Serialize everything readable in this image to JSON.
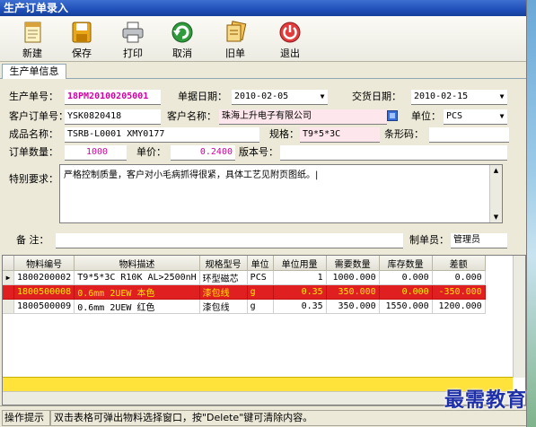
{
  "window": {
    "title": "生产订单录入"
  },
  "toolbar": {
    "new_label": "新建",
    "save_label": "保存",
    "print_label": "打印",
    "cancel_label": "取消",
    "old_label": "旧单",
    "exit_label": "退出"
  },
  "tab": {
    "label": "生产单信息"
  },
  "form": {
    "order_no_label": "生产单号：",
    "order_no": "18PM20100205001",
    "doc_date_label": "单据日期：",
    "doc_date": "2010-02-05",
    "delivery_date_label": "交货日期：",
    "delivery_date": "2010-02-15",
    "cust_order_label": "客户订单号：",
    "cust_order": "YSK0820418",
    "cust_name_label": "客户名称：",
    "cust_name": "珠海上升电子有限公司",
    "unit_label": "单位：",
    "unit": "PCS",
    "product_label": "成品名称：",
    "product": "TSRB-L0001    XMY0177",
    "spec_label": "规格：",
    "spec": "T9*5*3C",
    "barcode_label": "条形码：",
    "barcode": "",
    "qty_label": "订单数量：",
    "qty": "1000",
    "price_label": "单价：",
    "price": "0.2400",
    "version_label": "版本号：",
    "version": "",
    "special_label": "特别要求：",
    "special_text": "严格控制质量，客户对小毛病抓得很紧，具体工艺见附页图纸。|",
    "remark_label": "备  注：",
    "remark": "",
    "maker_label": "制单员：",
    "maker": "管理员"
  },
  "grid": {
    "columns": [
      "物料编号",
      "物料描述",
      "规格型号",
      "单位",
      "单位用量",
      "需要数量",
      "库存数量",
      "差额"
    ],
    "rows": [
      {
        "code": "1800200002",
        "desc": "T9*5*3C  R10K   AL>2500nH",
        "spec": "环型磁芯",
        "unit": "PCS",
        "usage": "1",
        "need": "1000.000",
        "stock": "0.000",
        "diff": "0.000"
      },
      {
        "code": "1800500008",
        "desc": "0.6mm  2UEW  本色",
        "spec": "漆包线",
        "unit": "g",
        "usage": "0.35",
        "need": "350.000",
        "stock": "0.000",
        "diff": "-350.000"
      },
      {
        "code": "1800500009",
        "desc": "0.6mm  2UEW   红色",
        "spec": "漆包线",
        "unit": "g",
        "usage": "0.35",
        "need": "350.000",
        "stock": "1550.000",
        "diff": "1200.000"
      }
    ]
  },
  "status": {
    "hint_label": "操作提示",
    "hint_text": "双击表格可弹出物料选择窗口，按\"Delete\"键可清除内容。"
  },
  "watermark": {
    "text": "最需教育"
  },
  "colors": {
    "title_bar": "#1f4fb8",
    "selected_row": "#e02020",
    "total_bar": "#ffe23a",
    "order_no": "#d000a0"
  }
}
